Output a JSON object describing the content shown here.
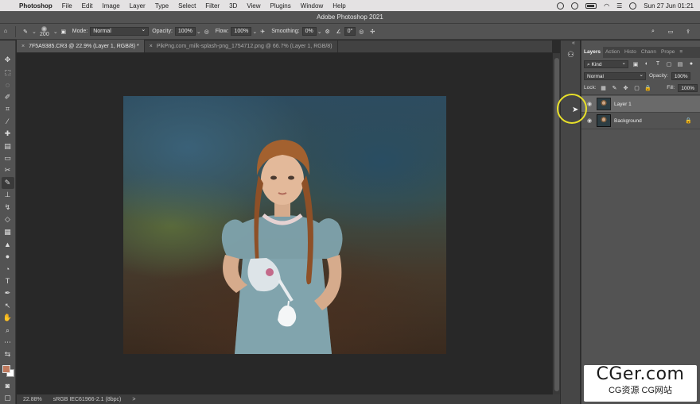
{
  "menubar": {
    "app_name": "Photoshop",
    "items": [
      "File",
      "Edit",
      "Image",
      "Layer",
      "Type",
      "Select",
      "Filter",
      "3D",
      "View",
      "Plugins",
      "Window",
      "Help"
    ],
    "clock": "Sun 27 Jun  01:21"
  },
  "window": {
    "title": "Adobe Photoshop 2021"
  },
  "options": {
    "brush_size": "200",
    "mode_label": "Mode:",
    "mode_value": "Normal",
    "opacity_label": "Opacity:",
    "opacity_value": "100%",
    "flow_label": "Flow:",
    "flow_value": "100%",
    "smoothing_label": "Smoothing:",
    "smoothing_value": "0%",
    "angle_value": "0°"
  },
  "tabs": [
    {
      "label": "7F5A9385.CR3 @ 22.9% (Layer 1, RGB/8) *",
      "active": true
    },
    {
      "label": "PikPng.com_milk-splash-png_1754712.png @ 66.7% (Layer 1, RGB/8)",
      "active": false
    }
  ],
  "status": {
    "zoom": "22.88%",
    "profile": "sRGB IEC61966-2.1 (8bpc)",
    "arrow": ">"
  },
  "layers_panel": {
    "tabs": [
      "Layers",
      "Action",
      "Histo",
      "Chann",
      "Prope"
    ],
    "filter_label": "Kind",
    "blend_mode": "Normal",
    "opacity_label": "Opacity:",
    "opacity_value": "100%",
    "lock_label": "Lock:",
    "fill_label": "Fill:",
    "fill_value": "100%",
    "layers": [
      {
        "name": "Layer 1",
        "selected": true,
        "locked": false
      },
      {
        "name": "Background",
        "selected": false,
        "locked": true
      }
    ]
  },
  "watermark": {
    "line1": "CGer.com",
    "line2": "CG资源 CG网站"
  },
  "colors": {
    "foreground": "#c07a5e",
    "background": "#ffffff",
    "panel": "#535353",
    "canvas": "#282828",
    "cursor_highlight": "#e8e02a"
  },
  "icons": {
    "tools": [
      "move-icon",
      "marquee-icon",
      "lasso-icon",
      "quick-select-icon",
      "crop-icon",
      "eyedropper-icon",
      "healing-icon",
      "patch-icon",
      "clone-icon",
      "brush-icon",
      "stamp-icon",
      "history-brush-icon",
      "eraser-icon",
      "gradient-icon",
      "blur-icon",
      "dodge-icon",
      "pen-icon",
      "type-icon",
      "path-select-icon",
      "hand-icon",
      "zoom-icon",
      "more-icon"
    ]
  }
}
